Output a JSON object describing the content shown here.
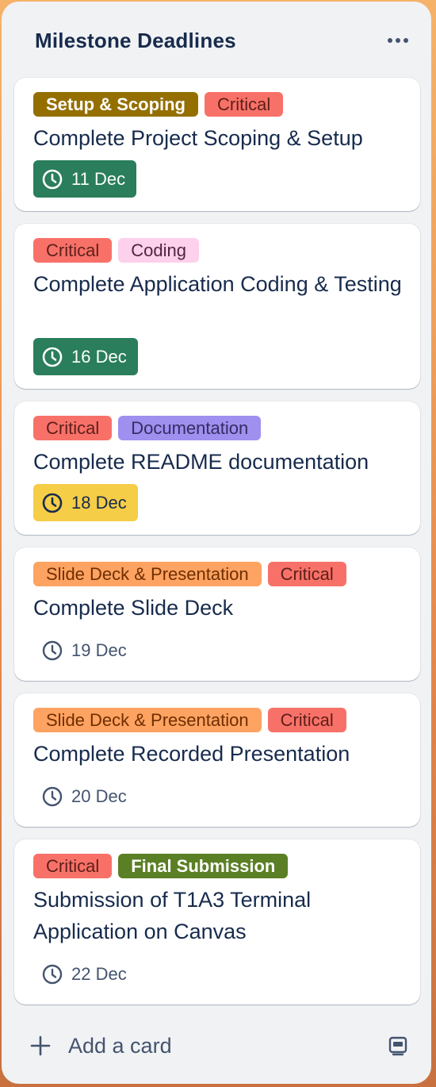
{
  "list": {
    "title": "Milestone Deadlines",
    "more_icon": "ellipsis-icon"
  },
  "colors": {
    "list_bg": "#f1f2f4",
    "card_bg": "#ffffff",
    "text": "#172b4d",
    "due_green": "#2a7e5b",
    "due_yellow": "#f5cd47"
  },
  "cards": [
    {
      "labels": [
        {
          "text": "Setup & Scoping",
          "color": "#946f00",
          "text_color": "#ffffff"
        },
        {
          "text": "Critical",
          "color": "#f87168",
          "text_color": "#5d1f1a"
        }
      ],
      "title": "Complete Project Scoping & Setup",
      "due": "11 Dec",
      "due_icon": "clock-icon",
      "due_style": "green"
    },
    {
      "labels": [
        {
          "text": "Critical",
          "color": "#f87168",
          "text_color": "#5d1f1a"
        },
        {
          "text": "Coding",
          "color": "#fdd0ec",
          "text_color": "#50253f"
        }
      ],
      "title": "Complete Application Coding & Testing",
      "due": "16 Dec",
      "due_icon": "clock-icon",
      "due_style": "green"
    },
    {
      "labels": [
        {
          "text": "Critical",
          "color": "#f87168",
          "text_color": "#5d1f1a"
        },
        {
          "text": "Documentation",
          "color": "#9f8fef",
          "text_color": "#352c63"
        }
      ],
      "title": "Complete README documentation",
      "due": "18 Dec",
      "due_icon": "clock-icon",
      "due_style": "yellow"
    },
    {
      "labels": [
        {
          "text": "Slide Deck & Presentation",
          "color": "#fea362",
          "text_color": "#702e00"
        },
        {
          "text": "Critical",
          "color": "#f87168",
          "text_color": "#5d1f1a"
        }
      ],
      "title": "Complete Slide Deck",
      "due": "19 Dec",
      "due_icon": "clock-icon",
      "due_style": "none"
    },
    {
      "labels": [
        {
          "text": "Slide Deck & Presentation",
          "color": "#fea362",
          "text_color": "#702e00"
        },
        {
          "text": "Critical",
          "color": "#f87168",
          "text_color": "#5d1f1a"
        }
      ],
      "title": "Complete Recorded Presentation",
      "due": "20 Dec",
      "due_icon": "clock-icon",
      "due_style": "none"
    },
    {
      "labels": [
        {
          "text": "Critical",
          "color": "#f87168",
          "text_color": "#5d1f1a"
        },
        {
          "text": "Final Submission",
          "color": "#5b7f24",
          "text_color": "#ffffff"
        }
      ],
      "title": "Submission of T1A3 Terminal Application on Canvas",
      "due": "22 Dec",
      "due_icon": "clock-icon",
      "due_style": "none"
    }
  ],
  "footer": {
    "add_card_label": "Add a card",
    "add_icon": "plus-icon",
    "template_icon": "card-template-icon"
  }
}
